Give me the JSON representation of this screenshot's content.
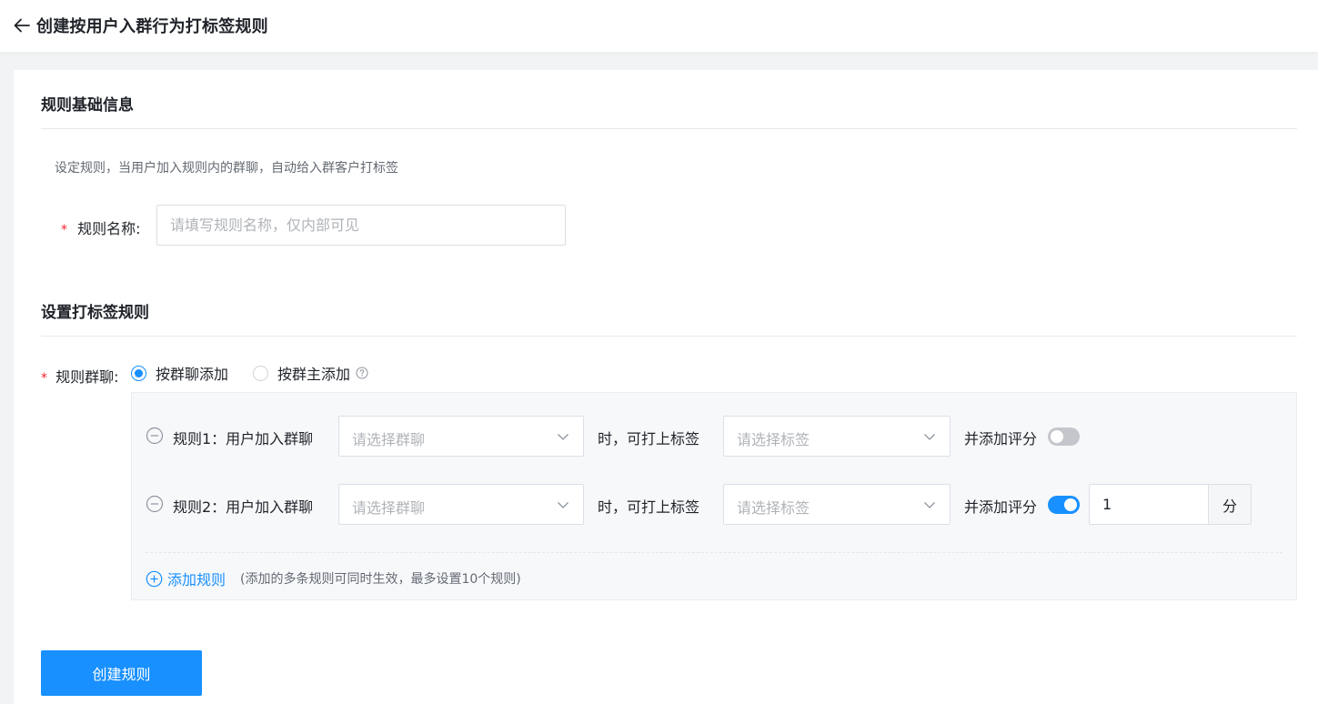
{
  "header": {
    "back_icon": "arrow-left-icon",
    "title": "创建按用户入群行为打标签规则"
  },
  "basic_info": {
    "section_title": "规则基础信息",
    "description": "设定规则，当用户加入规则内的群聊，自动给入群客户打标签",
    "name_field": {
      "required_mark": "*",
      "label": "规则名称:",
      "placeholder": "请填写规则名称，仅内部可见",
      "value": ""
    }
  },
  "tag_rules": {
    "section_title": "设置打标签规则",
    "group_field": {
      "required_mark": "*",
      "label": "规则群聊:",
      "options": [
        {
          "label": "按群聊添加",
          "checked": true
        },
        {
          "label": "按群主添加",
          "checked": false
        }
      ],
      "help_icon": "question-circle-icon"
    },
    "rules": [
      {
        "label": "规则1：用户加入群聊",
        "group_placeholder": "请选择群聊",
        "middle_text": "时，可打上标签",
        "tag_placeholder": "请选择标签",
        "score_label": "并添加评分",
        "score_enabled": false
      },
      {
        "label": "规则2：用户加入群聊",
        "group_placeholder": "请选择群聊",
        "middle_text": "时，可打上标签",
        "tag_placeholder": "请选择标签",
        "score_label": "并添加评分",
        "score_enabled": true,
        "score_value": "1",
        "score_unit": "分"
      }
    ],
    "add_rule": {
      "label": "添加规则",
      "note": "(添加的多条规则可同时生效，最多设置10个规则)",
      "icon": "plus-circle-icon"
    }
  },
  "submit": {
    "label": "创建规则"
  },
  "colors": {
    "primary": "#1890ff",
    "required": "#f5222d",
    "switch_off": "#c4c6cc"
  }
}
